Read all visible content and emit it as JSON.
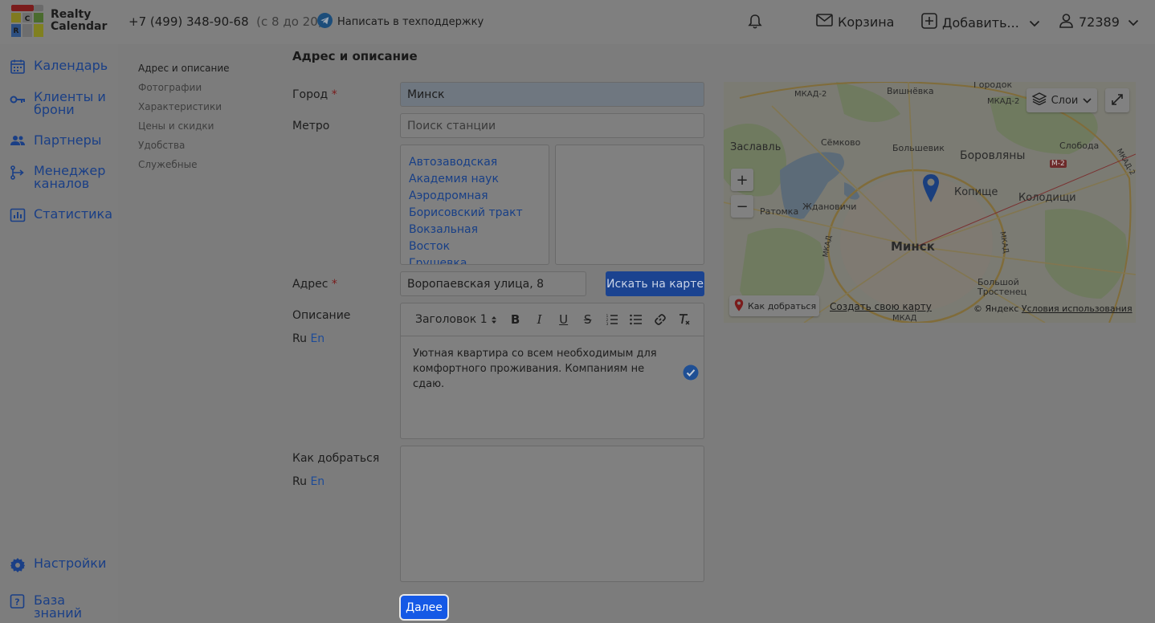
{
  "app": {
    "logo_letters": [
      "C",
      "R"
    ],
    "logo_text_line1": "Realty",
    "logo_text_line2": "Calendar"
  },
  "header": {
    "phone": "+7 (499) 348-90-68",
    "hours": "(с 8 до 20)",
    "support_link": "Написать в техподдержку",
    "cart_label": "Корзина",
    "add_label": "Добавить...",
    "user_id": "72389",
    "icons": [
      "telegram-icon",
      "bell-icon",
      "mail-icon",
      "plus-square-icon",
      "chevron-down-icon",
      "user-icon"
    ]
  },
  "sidebar": {
    "items": [
      {
        "label": "Календарь",
        "icon": "calendar-icon"
      },
      {
        "label": "Клиенты и брони",
        "icon": "key-icon"
      },
      {
        "label": "Партнеры",
        "icon": "people-icon"
      },
      {
        "label": "Менеджер каналов",
        "icon": "channels-icon"
      },
      {
        "label": "Статистика",
        "icon": "chart-icon"
      }
    ],
    "bottom_items": [
      {
        "label": "Настройки",
        "icon": "gear-icon"
      },
      {
        "label": "База знаний",
        "icon": "question-icon"
      }
    ]
  },
  "subnav": {
    "items": [
      "Адрес и описание",
      "Фотографии",
      "Характеристики",
      "Цены и скидки",
      "Удобства",
      "Служебные"
    ],
    "active_index": 0
  },
  "form": {
    "section_title": "Адрес и описание",
    "city_label": "Город",
    "city_value": "Минск",
    "required_mark": "*",
    "metro_label": "Метро",
    "metro_placeholder": "Поиск станции",
    "metro_stations": [
      "Автозаводская",
      "Академия наук",
      "Аэродромная",
      "Борисовский тракт",
      "Вокзальная",
      "Восток",
      "Грушевка"
    ],
    "address_label": "Адрес",
    "address_value": "Воропаевская улица, 8",
    "search_map_button": "Искать на карте",
    "description_label": "Описание",
    "lang_ru": "Ru",
    "lang_en": "En",
    "heading_select": "Заголовок 1",
    "description_text": "Уютная квартира со всем необходимым для комфортного проживания. Компаниям не сдаю.",
    "directions_label": "Как добраться",
    "next_button": "Далее"
  },
  "map": {
    "layers_button": "Слои",
    "labels": [
      "Городок",
      "Вишнёвка",
      "МКАД-2",
      "МКАД-2",
      "Сёмково",
      "Большевик",
      "Боровляны",
      "Заславль",
      "Слобода",
      "Копище",
      "Колодищи",
      "Ратомка",
      "Ждановичи",
      "Минск",
      "МКАД",
      "МКАД",
      "МКАД-2",
      "Большой Тростенец",
      "М-2",
      "МКАД"
    ],
    "how_to_get_label": "Как добраться",
    "create_map_link": "Создать свою карту",
    "copyright": "© Яндекс",
    "terms_link": "Условия использования",
    "controls": [
      "+",
      "−"
    ]
  },
  "colors": {
    "accent": "#1559e6",
    "link": "#1d4b98",
    "required": "#7a1a1a",
    "overlay_gray": "#7c7c7c"
  }
}
